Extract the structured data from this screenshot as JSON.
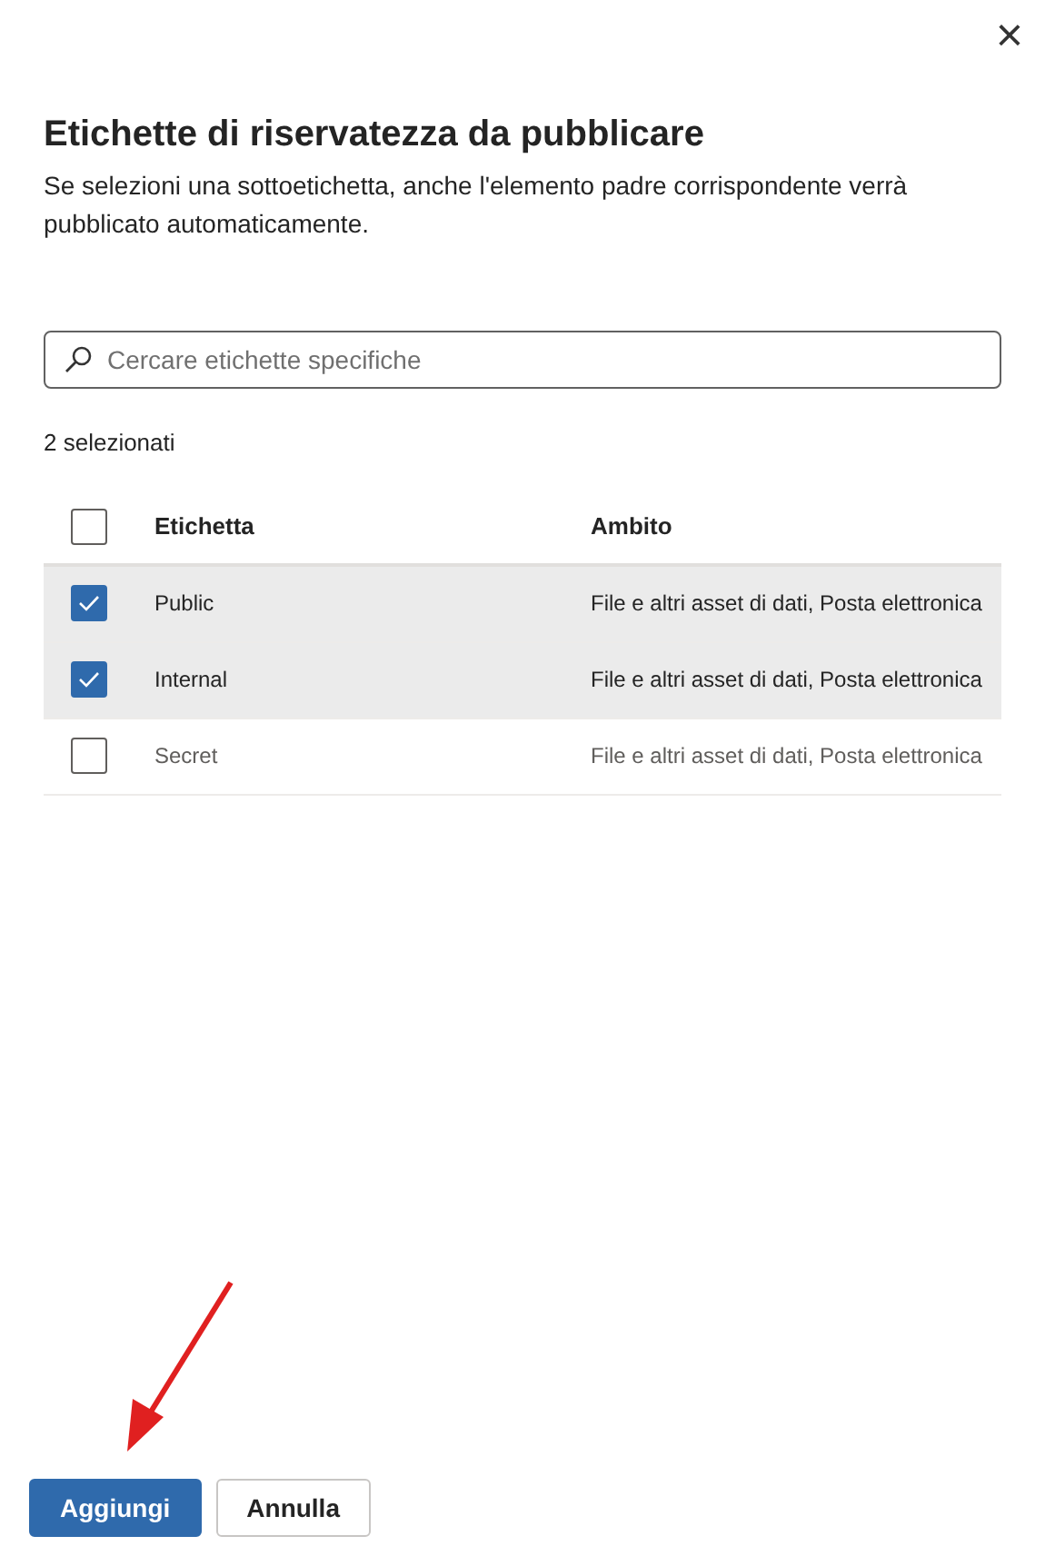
{
  "dialog": {
    "close": "×",
    "title": "Etichette di riservatezza da pubblicare",
    "description": "Se selezioni una sottoetichetta, anche l'elemento padre corrispondente verrà pubblicato automaticamente."
  },
  "search": {
    "placeholder": "Cercare etichette specifiche"
  },
  "selection_count": "2 selezionati",
  "table": {
    "select_all_checked": false,
    "columns": [
      "Etichetta",
      "Ambito"
    ],
    "rows": [
      {
        "label": "Public",
        "scope": "File e altri asset di dati, Posta elettronica",
        "selected": true
      },
      {
        "label": "Internal",
        "scope": "File e altri asset di dati, Posta elettronica",
        "selected": true
      },
      {
        "label": "Secret",
        "scope": "File e altri asset di dati, Posta elettronica",
        "selected": false
      }
    ]
  },
  "buttons": [
    {
      "label": "Aggiungi",
      "kind": "primary"
    },
    {
      "label": "Annulla",
      "kind": "secondary"
    }
  ]
}
